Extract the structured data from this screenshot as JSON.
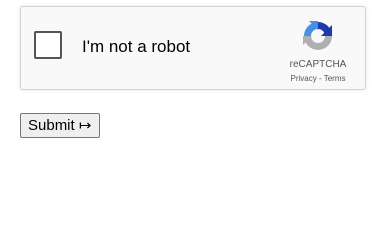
{
  "captcha": {
    "label": "I'm not a robot",
    "brand": "reCAPTCHA",
    "privacy_link": "Privacy",
    "separator": " - ",
    "terms_link": "Terms",
    "logo_icon": "recaptcha-logo-icon",
    "colors": {
      "logo_blue_dark": "#1c3aa9",
      "logo_blue": "#4a90e2",
      "logo_gray": "#b0b0b0"
    }
  },
  "form": {
    "submit_label": "Submit ↦"
  }
}
